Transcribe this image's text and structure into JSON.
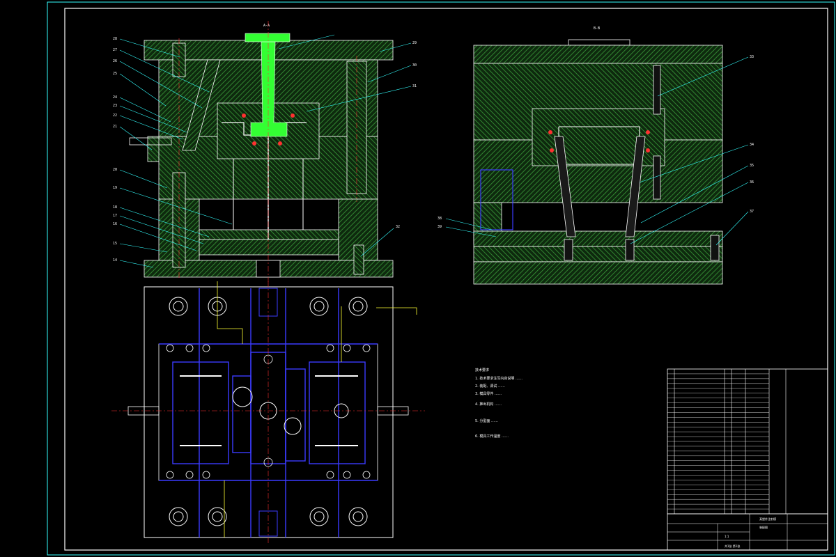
{
  "drawing": {
    "view_labels": {
      "section_aa": "A-A",
      "section_bb": "B-B"
    },
    "notes_title": "技术要求",
    "notes": [
      "1. 技术要求注写内容说明 ……",
      "2. 装配、调试 ……",
      "3. 模具零件 ……",
      "4. 推出机构 ……",
      "",
      "5. 分型面 ……",
      "",
      "6. 模具工作温度 ……"
    ],
    "balloons_main_left": [
      "28",
      "27",
      "26",
      "25",
      "24",
      "23",
      "22",
      "21",
      "20",
      "19",
      "18",
      "17",
      "16",
      "15",
      "14"
    ],
    "balloons_main_right": [
      "29",
      "30",
      "31",
      "32"
    ],
    "balloons_side": [
      "33",
      "34",
      "35",
      "36",
      "37",
      "38",
      "39"
    ],
    "title_block": {
      "name": "某塑件注射模",
      "subname": "装配图",
      "scale": "1:1",
      "sheet": "共1张 第1张"
    }
  },
  "colors": {
    "background": "#000000",
    "hatch": "#2f8f2f",
    "line": "#ffffff",
    "green_sprue": "#33ff33",
    "blue": "#3b3bff",
    "yellow": "#ffff33",
    "cyan_leader": "#33ffff",
    "red_center": "#ff3030"
  }
}
